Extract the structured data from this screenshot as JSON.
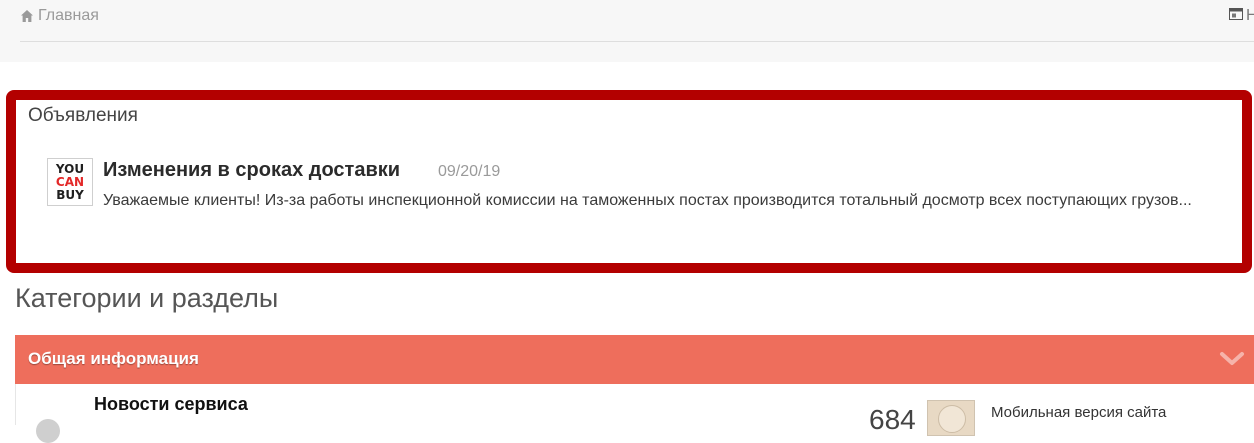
{
  "topbar": {
    "breadcrumb_home": "Главная",
    "right_label": "Н"
  },
  "announcements": {
    "header": "Объявления",
    "logo_lines": [
      "YOU",
      "CAN",
      "BUY"
    ],
    "item": {
      "title": "Изменения в сроках доставки",
      "date": "09/20/19",
      "excerpt": "Уважаемые клиенты! Из-за работы инспекционной комиссии на таможенных постах производится тотальный досмотр всех поступающих грузов..."
    }
  },
  "categories": {
    "section_title": "Категории и разделы",
    "category_title": "Общая информация",
    "forum": {
      "name": "Новости сервиса",
      "count": "684",
      "last_post": "Мобильная версия сайта"
    }
  },
  "colors": {
    "highlight_frame": "#b30000",
    "category_bar": "#ee6e5c",
    "logo_accent": "#e32828"
  },
  "icons": {
    "home": "home-icon",
    "top_right": "window-icon",
    "toggle": "chevron-down-icon"
  }
}
